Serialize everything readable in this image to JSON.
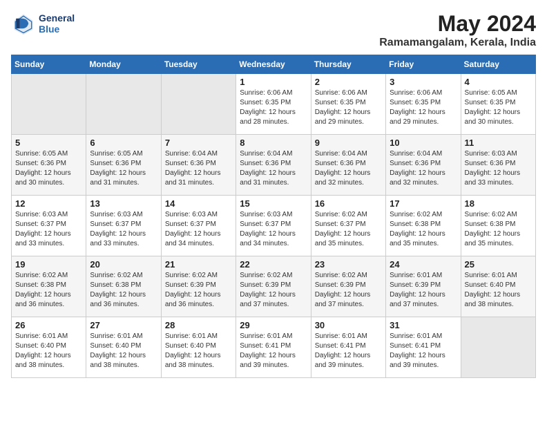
{
  "header": {
    "logo_line1": "General",
    "logo_line2": "Blue",
    "month_year": "May 2024",
    "location": "Ramamangalam, Kerala, India"
  },
  "days_of_week": [
    "Sunday",
    "Monday",
    "Tuesday",
    "Wednesday",
    "Thursday",
    "Friday",
    "Saturday"
  ],
  "weeks": [
    [
      {
        "day": "",
        "empty": true
      },
      {
        "day": "",
        "empty": true
      },
      {
        "day": "",
        "empty": true
      },
      {
        "day": "1",
        "sunrise": "6:06 AM",
        "sunset": "6:35 PM",
        "daylight": "12 hours and 28 minutes."
      },
      {
        "day": "2",
        "sunrise": "6:06 AM",
        "sunset": "6:35 PM",
        "daylight": "12 hours and 29 minutes."
      },
      {
        "day": "3",
        "sunrise": "6:06 AM",
        "sunset": "6:35 PM",
        "daylight": "12 hours and 29 minutes."
      },
      {
        "day": "4",
        "sunrise": "6:05 AM",
        "sunset": "6:35 PM",
        "daylight": "12 hours and 30 minutes."
      }
    ],
    [
      {
        "day": "5",
        "sunrise": "6:05 AM",
        "sunset": "6:36 PM",
        "daylight": "12 hours and 30 minutes."
      },
      {
        "day": "6",
        "sunrise": "6:05 AM",
        "sunset": "6:36 PM",
        "daylight": "12 hours and 31 minutes."
      },
      {
        "day": "7",
        "sunrise": "6:04 AM",
        "sunset": "6:36 PM",
        "daylight": "12 hours and 31 minutes."
      },
      {
        "day": "8",
        "sunrise": "6:04 AM",
        "sunset": "6:36 PM",
        "daylight": "12 hours and 31 minutes."
      },
      {
        "day": "9",
        "sunrise": "6:04 AM",
        "sunset": "6:36 PM",
        "daylight": "12 hours and 32 minutes."
      },
      {
        "day": "10",
        "sunrise": "6:04 AM",
        "sunset": "6:36 PM",
        "daylight": "12 hours and 32 minutes."
      },
      {
        "day": "11",
        "sunrise": "6:03 AM",
        "sunset": "6:36 PM",
        "daylight": "12 hours and 33 minutes."
      }
    ],
    [
      {
        "day": "12",
        "sunrise": "6:03 AM",
        "sunset": "6:37 PM",
        "daylight": "12 hours and 33 minutes."
      },
      {
        "day": "13",
        "sunrise": "6:03 AM",
        "sunset": "6:37 PM",
        "daylight": "12 hours and 33 minutes."
      },
      {
        "day": "14",
        "sunrise": "6:03 AM",
        "sunset": "6:37 PM",
        "daylight": "12 hours and 34 minutes."
      },
      {
        "day": "15",
        "sunrise": "6:03 AM",
        "sunset": "6:37 PM",
        "daylight": "12 hours and 34 minutes."
      },
      {
        "day": "16",
        "sunrise": "6:02 AM",
        "sunset": "6:37 PM",
        "daylight": "12 hours and 35 minutes."
      },
      {
        "day": "17",
        "sunrise": "6:02 AM",
        "sunset": "6:38 PM",
        "daylight": "12 hours and 35 minutes."
      },
      {
        "day": "18",
        "sunrise": "6:02 AM",
        "sunset": "6:38 PM",
        "daylight": "12 hours and 35 minutes."
      }
    ],
    [
      {
        "day": "19",
        "sunrise": "6:02 AM",
        "sunset": "6:38 PM",
        "daylight": "12 hours and 36 minutes."
      },
      {
        "day": "20",
        "sunrise": "6:02 AM",
        "sunset": "6:38 PM",
        "daylight": "12 hours and 36 minutes."
      },
      {
        "day": "21",
        "sunrise": "6:02 AM",
        "sunset": "6:39 PM",
        "daylight": "12 hours and 36 minutes."
      },
      {
        "day": "22",
        "sunrise": "6:02 AM",
        "sunset": "6:39 PM",
        "daylight": "12 hours and 37 minutes."
      },
      {
        "day": "23",
        "sunrise": "6:02 AM",
        "sunset": "6:39 PM",
        "daylight": "12 hours and 37 minutes."
      },
      {
        "day": "24",
        "sunrise": "6:01 AM",
        "sunset": "6:39 PM",
        "daylight": "12 hours and 37 minutes."
      },
      {
        "day": "25",
        "sunrise": "6:01 AM",
        "sunset": "6:40 PM",
        "daylight": "12 hours and 38 minutes."
      }
    ],
    [
      {
        "day": "26",
        "sunrise": "6:01 AM",
        "sunset": "6:40 PM",
        "daylight": "12 hours and 38 minutes."
      },
      {
        "day": "27",
        "sunrise": "6:01 AM",
        "sunset": "6:40 PM",
        "daylight": "12 hours and 38 minutes."
      },
      {
        "day": "28",
        "sunrise": "6:01 AM",
        "sunset": "6:40 PM",
        "daylight": "12 hours and 38 minutes."
      },
      {
        "day": "29",
        "sunrise": "6:01 AM",
        "sunset": "6:41 PM",
        "daylight": "12 hours and 39 minutes."
      },
      {
        "day": "30",
        "sunrise": "6:01 AM",
        "sunset": "6:41 PM",
        "daylight": "12 hours and 39 minutes."
      },
      {
        "day": "31",
        "sunrise": "6:01 AM",
        "sunset": "6:41 PM",
        "daylight": "12 hours and 39 minutes."
      },
      {
        "day": "",
        "empty": true
      }
    ]
  ],
  "labels": {
    "sunrise_prefix": "Sunrise:",
    "sunset_prefix": "Sunset:",
    "daylight_prefix": "Daylight:"
  }
}
